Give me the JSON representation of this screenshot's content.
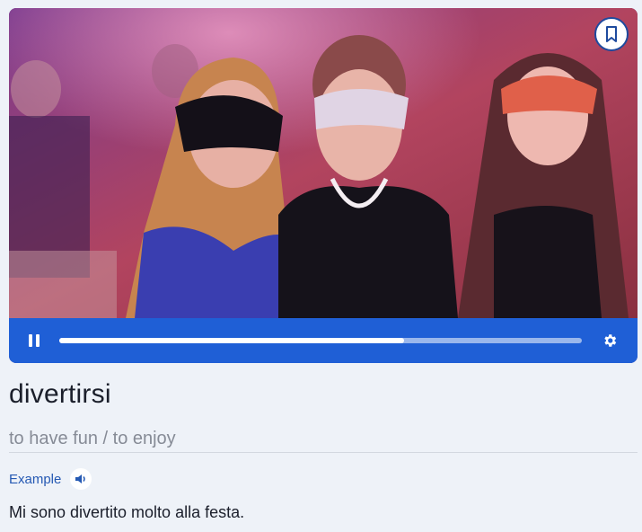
{
  "video": {
    "image": "party-masquerade-photo",
    "progress": 0.66,
    "icons": {
      "bookmark": "bookmark-icon",
      "pause": "pause-icon",
      "settings": "gear-icon"
    }
  },
  "entry": {
    "word": "divertirsi",
    "translation": "to have fun / to enjoy"
  },
  "example": {
    "label": "Example",
    "audio_icon": "speaker-icon",
    "sentence": "Mi sono divertito molto alla festa."
  },
  "colors": {
    "accent": "#1f5fd6",
    "link": "#2559b3",
    "muted": "#868b96",
    "background": "#eef2f8"
  }
}
